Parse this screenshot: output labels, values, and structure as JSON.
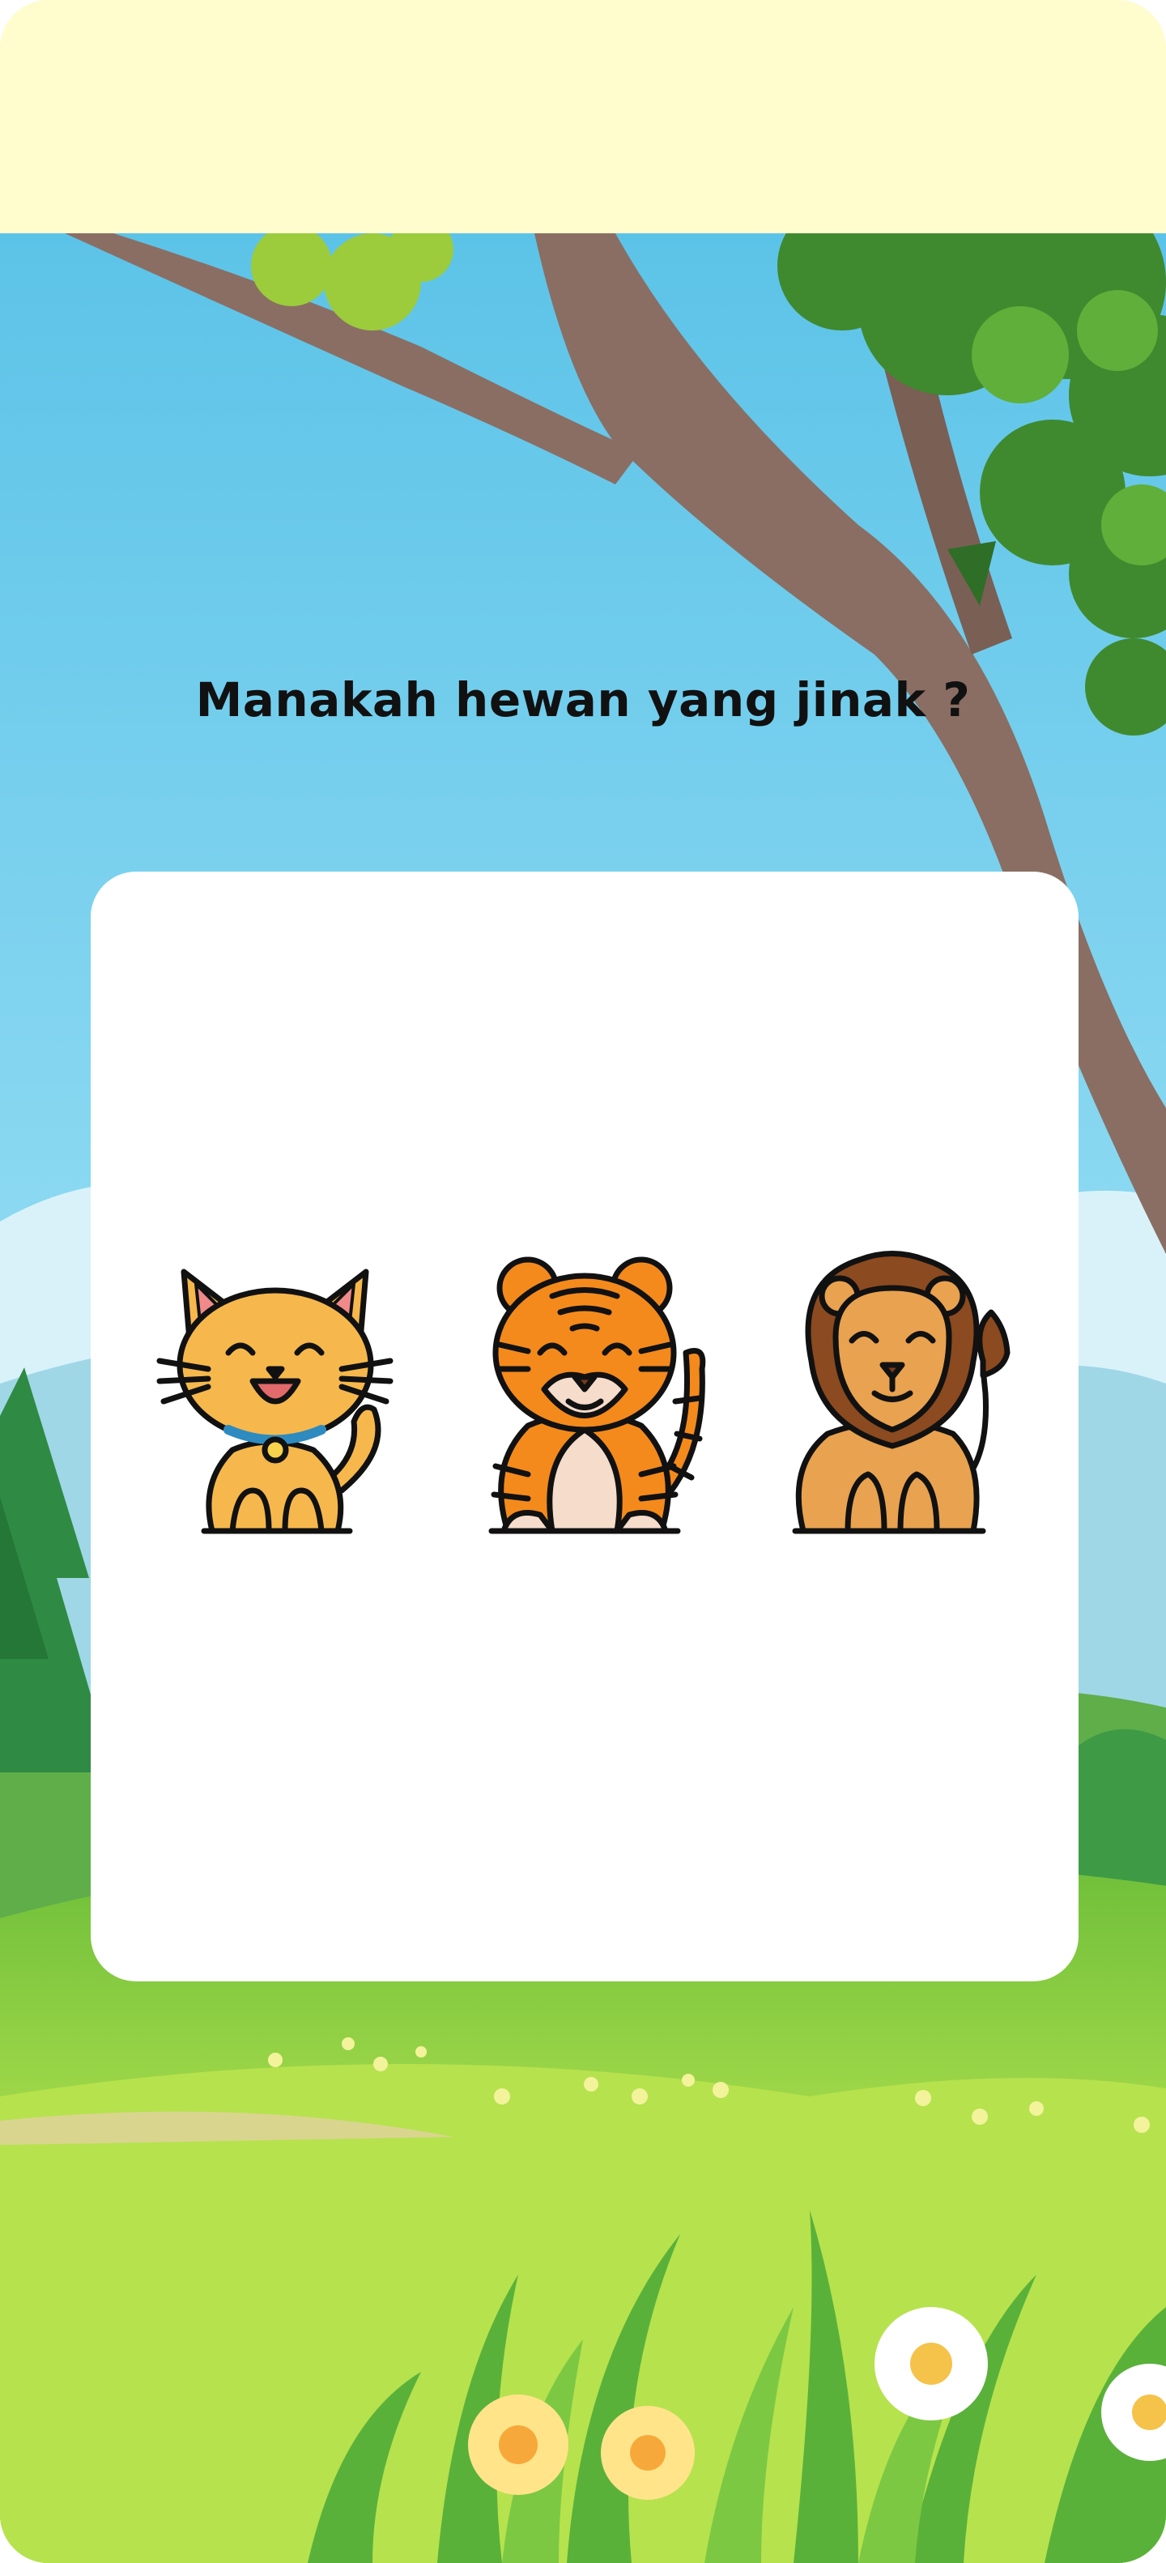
{
  "quiz": {
    "question": "Manakah hewan yang jinak ?",
    "options": [
      {
        "name": "cat",
        "icon": "cat-icon"
      },
      {
        "name": "tiger",
        "icon": "tiger-icon"
      },
      {
        "name": "lion",
        "icon": "lion-icon"
      }
    ]
  },
  "colors": {
    "header_background": "#FFFCCE",
    "sky": "#74CDEB",
    "grass": "#8FD14A",
    "card": "#FFFFFF",
    "question_text": "#111111"
  }
}
